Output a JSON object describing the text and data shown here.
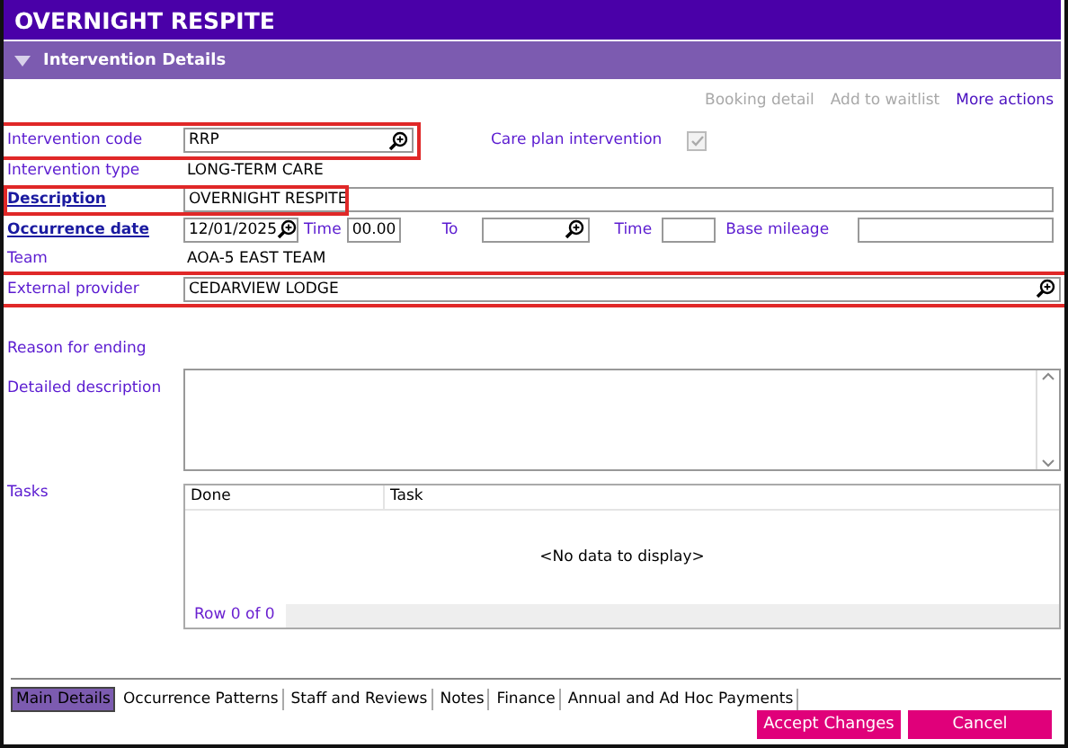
{
  "window": {
    "title": "OVERNIGHT RESPITE"
  },
  "section": {
    "title": "Intervention Details",
    "expanded": true
  },
  "actions": [
    {
      "label": "Booking detail",
      "disabled": true
    },
    {
      "label": "Add to waitlist",
      "disabled": true
    },
    {
      "label": "More actions",
      "disabled": false
    }
  ],
  "intervention_code": {
    "label": "Intervention code",
    "value": "RRP",
    "highlighted": true
  },
  "care_plan": {
    "label": "Care plan intervention",
    "checked": true,
    "disabled": true
  },
  "intervention_type": {
    "label": "Intervention type",
    "value": "LONG-TERM CARE"
  },
  "description": {
    "label": "Description",
    "value": "OVERNIGHT RESPITE",
    "highlighted": true
  },
  "occurrence": {
    "label": "Occurrence date",
    "date": "12/01/2025",
    "time_label": "Time",
    "time": "00.00",
    "to_label": "To",
    "to_time_label": "Time",
    "mileage_label": "Base mileage"
  },
  "team": {
    "label": "Team",
    "value": "AOA-5 EAST TEAM"
  },
  "external_provider": {
    "label": "External provider",
    "value": "CEDARVIEW LODGE",
    "highlighted": true
  },
  "reason": {
    "label": "Reason for ending"
  },
  "detailed_description": {
    "label": "Detailed description"
  },
  "tasks": {
    "label": "Tasks",
    "columns": [
      "Done",
      "Task"
    ],
    "empty": "<No data to display>",
    "row_count": "Row 0 of 0"
  },
  "tabs": [
    {
      "label": "Main Details",
      "selected": true
    },
    {
      "label": "Occurrence Patterns",
      "selected": false
    },
    {
      "label": "Staff and Reviews",
      "selected": false
    },
    {
      "label": "Notes",
      "selected": false
    },
    {
      "label": "Finance",
      "selected": false
    },
    {
      "label": "Annual and Ad Hoc Payments",
      "selected": false
    }
  ],
  "buttons": [
    "Accept Changes",
    "Cancel"
  ]
}
